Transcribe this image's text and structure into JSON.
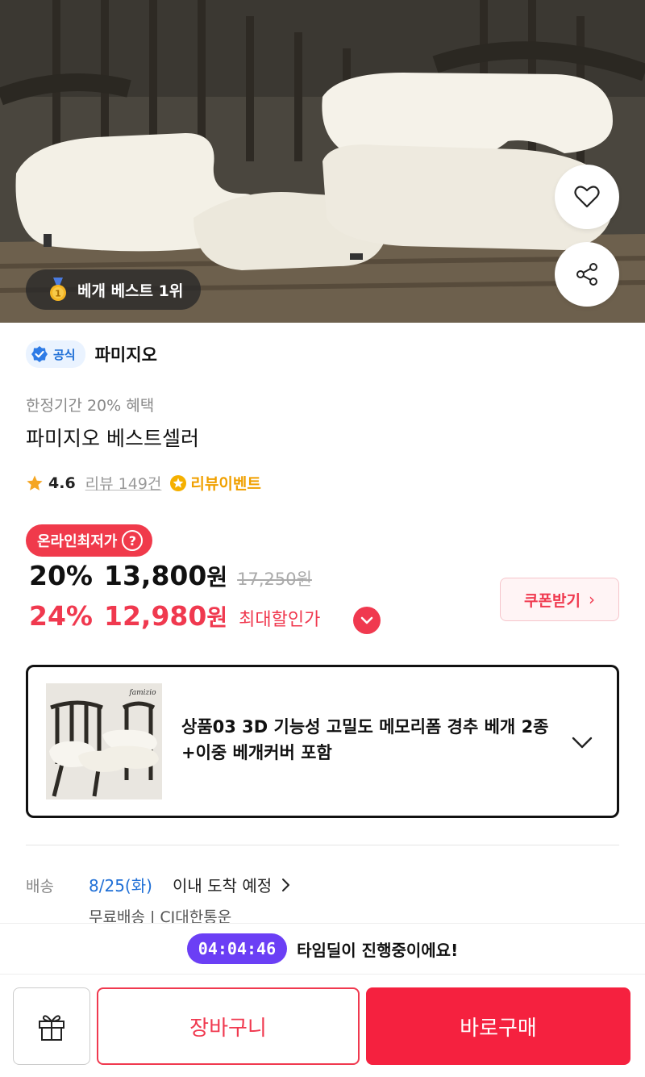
{
  "hero": {
    "rank_badge": "베개 베스트 1위",
    "icons": {
      "like": "heart-icon",
      "share": "share-icon",
      "medal": "medal-icon"
    }
  },
  "brand": {
    "official_label": "공식",
    "name": "파미지오"
  },
  "product": {
    "promo": "한정기간 20% 혜택",
    "title": "파미지오 베스트셀러",
    "rating": "4.6",
    "review_link": "리뷰 149건",
    "review_event": "리뷰이벤트"
  },
  "pricing": {
    "lowest_badge": "온라인최저가",
    "lowest_help": "?",
    "sale_percent": "20%",
    "sale_amount": "13,800",
    "currency": "원",
    "original_price": "17,250원",
    "max_percent": "24%",
    "max_amount": "12,980",
    "max_label": "최대할인가",
    "coupon_button": "쿠폰받기"
  },
  "option": {
    "thumb_brand": "famizio",
    "text": "상품03 3D 기능성 고밀도 메모리폼 경추 베개 2종+이중 베개커버 포함"
  },
  "shipping": {
    "label": "배송",
    "date": "8/25(화)",
    "rest": "이내 도착 예정",
    "sub": "무료배송 | CJ대한통운"
  },
  "timer": {
    "time": "04:04:46",
    "text": "타임딜이 진행중이에요!"
  },
  "actions": {
    "cart": "장바구니",
    "buy": "바로구매"
  },
  "colors": {
    "accent_red": "#f0394f",
    "buy_red": "#f5213f",
    "timer_purple": "#6b3ff5",
    "link_blue": "#1f6fd6",
    "event_orange": "#f0a000"
  }
}
